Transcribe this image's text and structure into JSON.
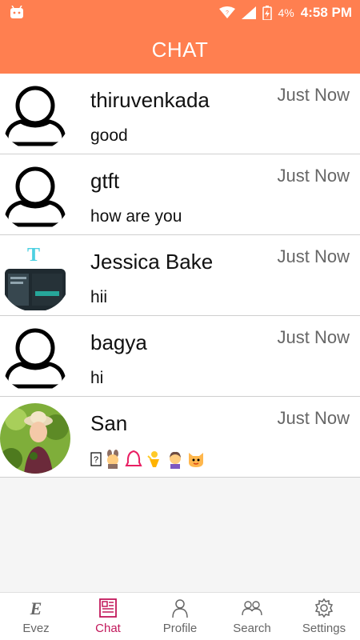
{
  "status_bar": {
    "battery": "4%",
    "time": "4:58 PM"
  },
  "app_bar": {
    "title": "CHAT"
  },
  "chats": [
    {
      "name": "thiruvenkada",
      "time": "Just Now",
      "message": "good",
      "avatar": "default-person-icon"
    },
    {
      "name": "gtft",
      "time": "Just Now",
      "message": "how are you",
      "avatar": "default-person-icon"
    },
    {
      "name": "Jessica Bake",
      "time": "Just Now",
      "message": "hii",
      "avatar": "app-screenshot-photo"
    },
    {
      "name": "bagya",
      "time": "Just Now",
      "message": "hi",
      "avatar": "default-person-icon"
    },
    {
      "name": "San",
      "time": "Just Now",
      "message_emojis": [
        "unknown-glyph",
        "bunny-emoji",
        "bell-emoji",
        "dancer-emoji",
        "girl-emoji",
        "cat-emoji"
      ],
      "avatar": "girl-photo"
    }
  ],
  "bottom_nav": {
    "items": [
      {
        "label": "Evez",
        "icon": "evez-logo-icon"
      },
      {
        "label": "Chat",
        "icon": "newspaper-icon",
        "active": true
      },
      {
        "label": "Profile",
        "icon": "person-icon"
      },
      {
        "label": "Search",
        "icon": "people-icon"
      },
      {
        "label": "Settings",
        "icon": "gear-icon"
      }
    ]
  },
  "colors": {
    "primary": "#ff7f50",
    "active_nav": "#c2185b",
    "inactive_nav": "#666666"
  }
}
